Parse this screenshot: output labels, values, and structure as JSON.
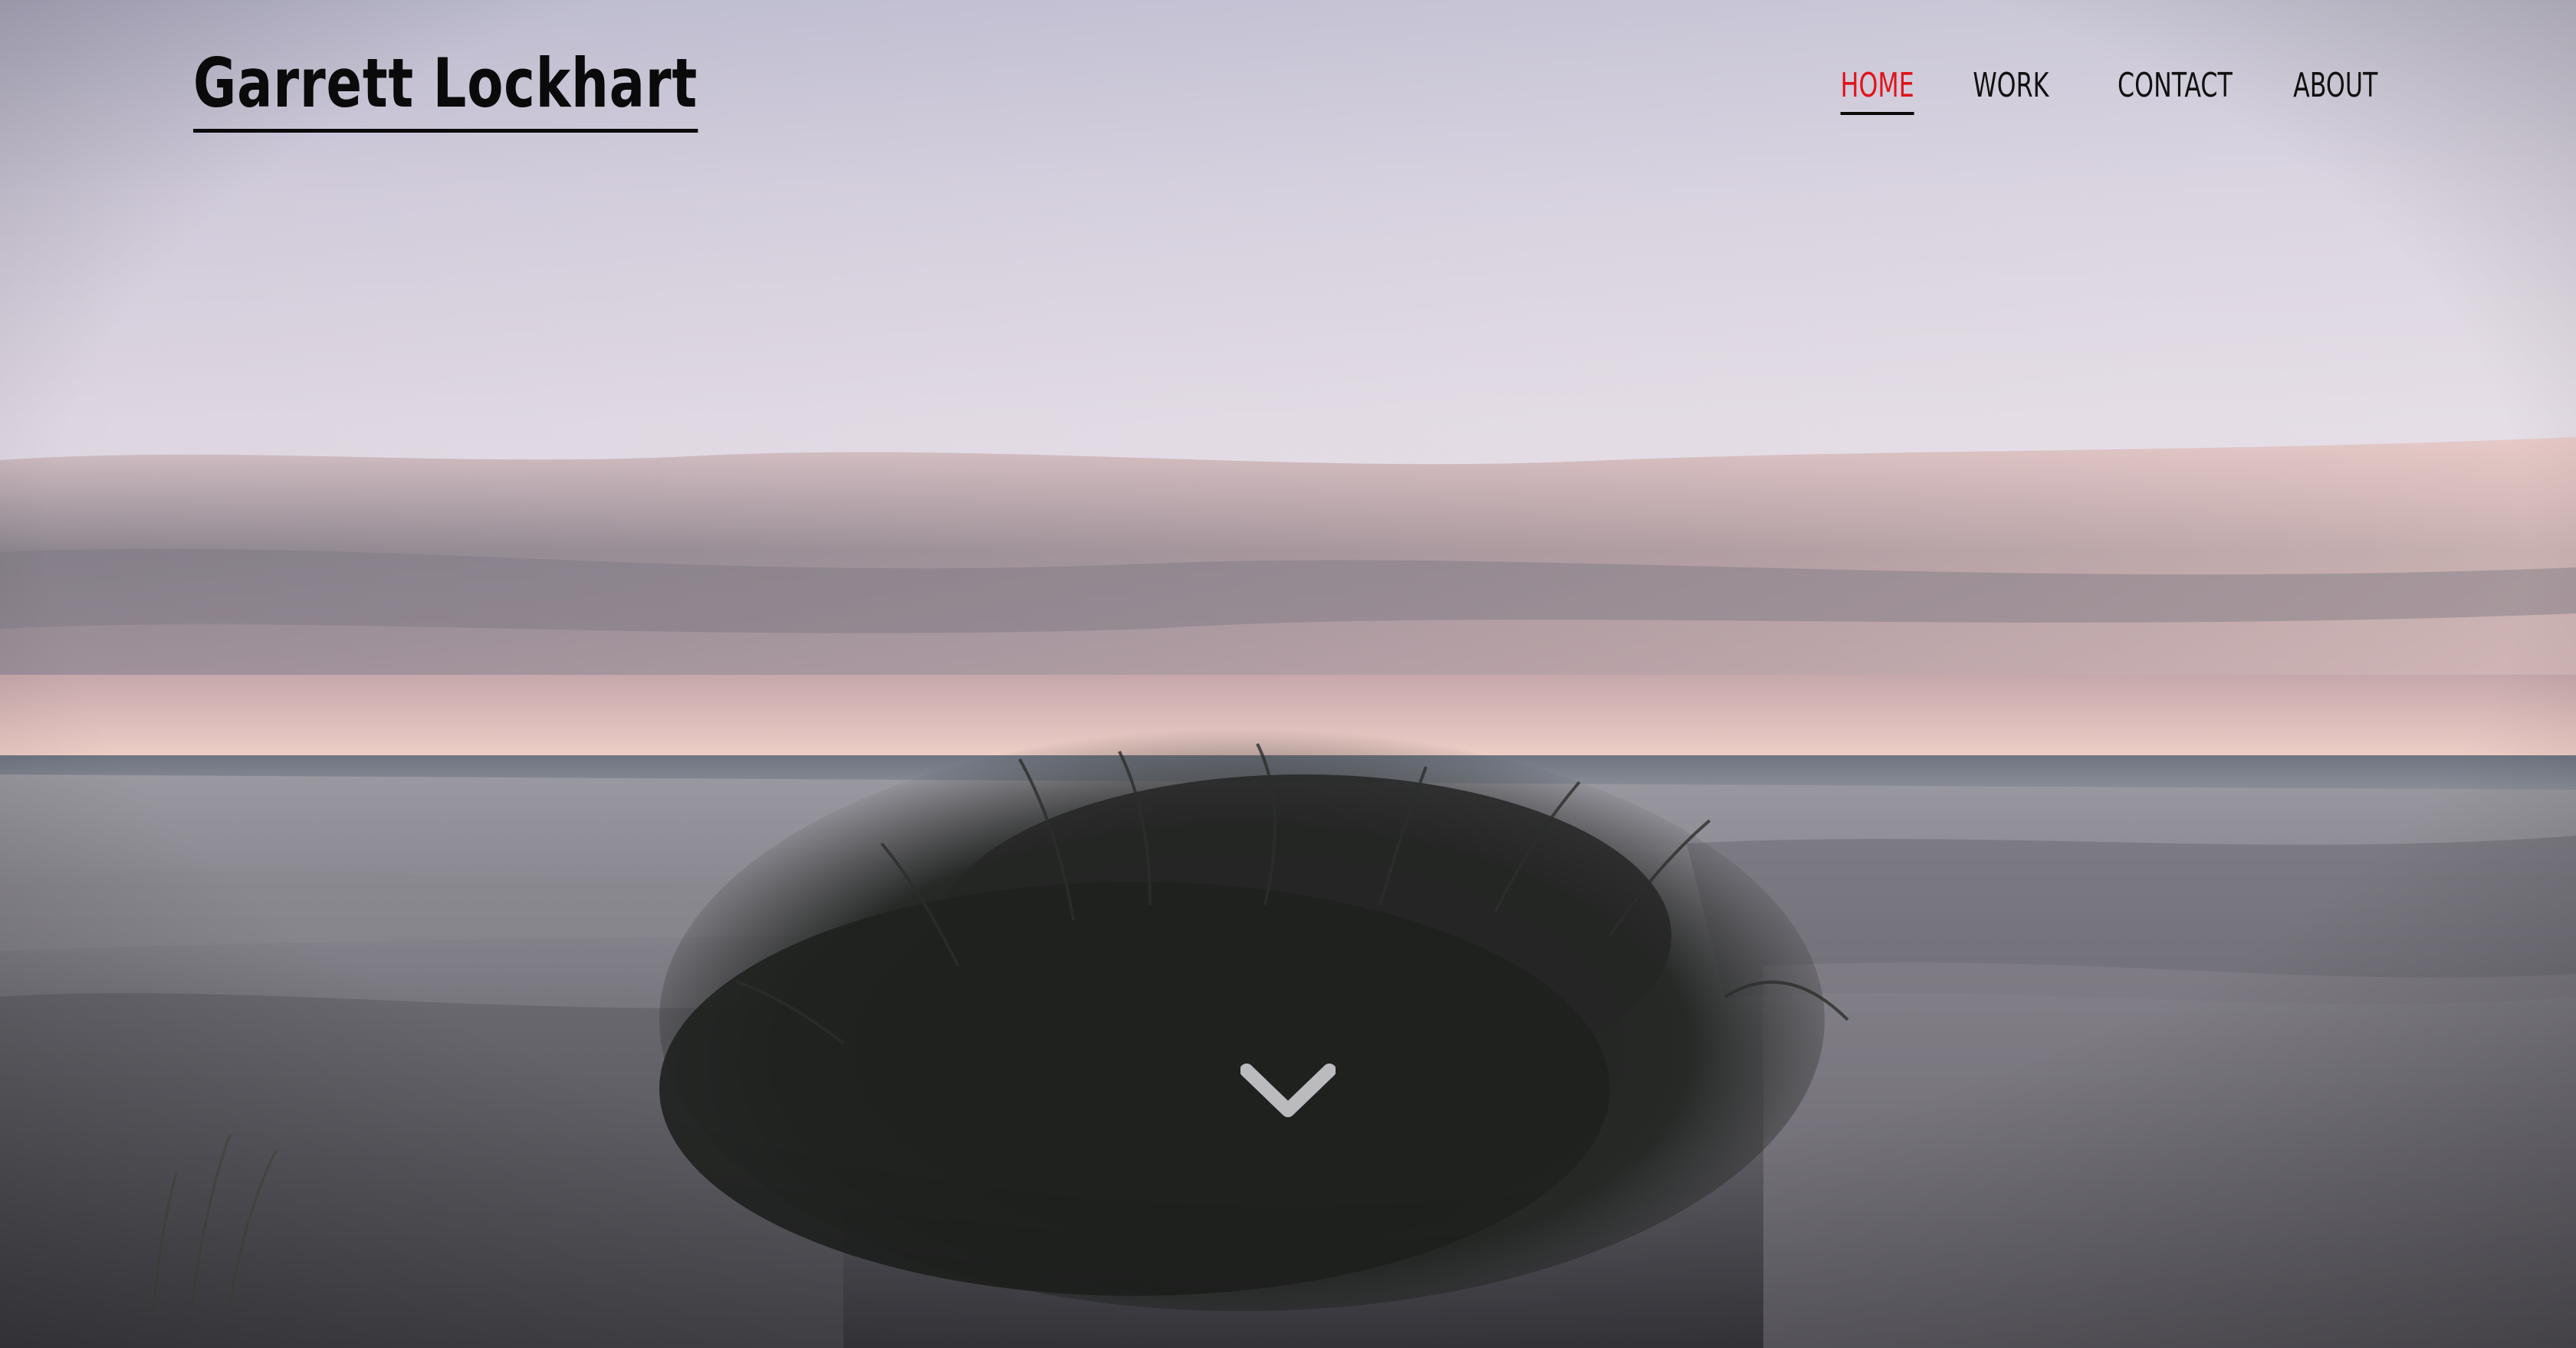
{
  "site": {
    "title": "Garrett Lockhart"
  },
  "nav": {
    "items": [
      {
        "label": "HOME",
        "active": true
      },
      {
        "label": "WORK",
        "active": false
      },
      {
        "label": "CONTACT",
        "active": false
      },
      {
        "label": "ABOUT",
        "active": false
      }
    ]
  },
  "colors": {
    "accent": "#e0141b",
    "text": "#0a0a0a"
  },
  "icons": {
    "scroll": "chevron-down-icon"
  }
}
